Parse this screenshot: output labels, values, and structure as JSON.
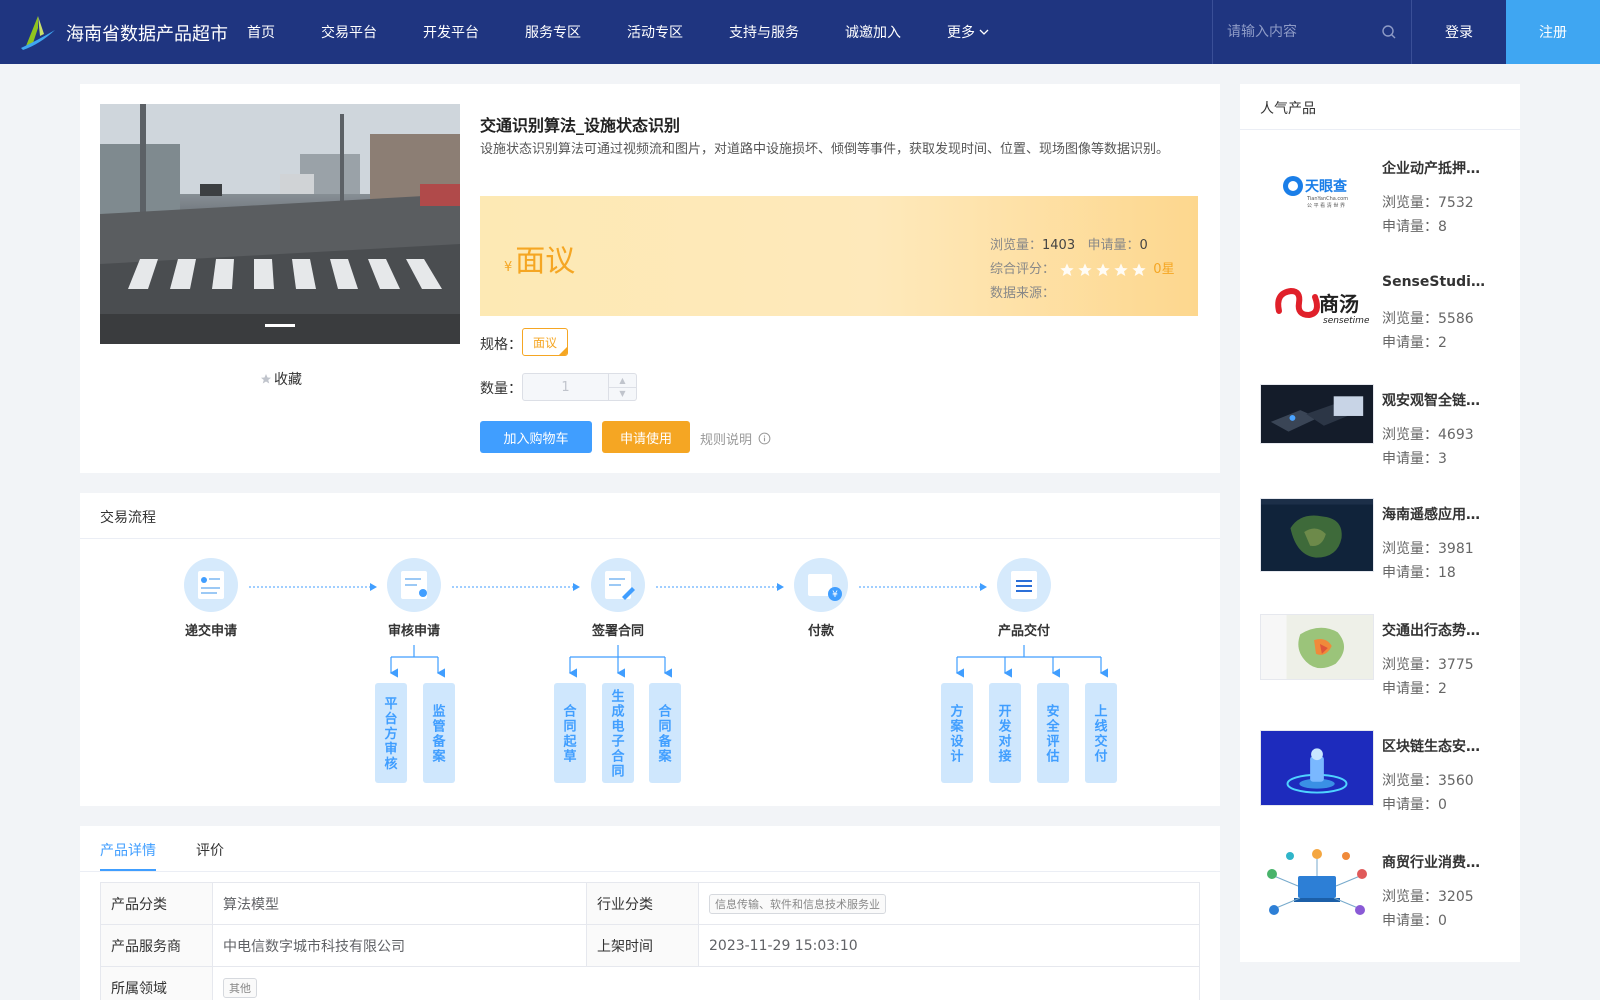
{
  "header": {
    "brand": "海南省数据产品超市",
    "nav": [
      "首页",
      "交易平台",
      "开发平台",
      "服务专区",
      "活动专区",
      "支持与服务",
      "诚邀加入"
    ],
    "more": "更多",
    "search_placeholder": "请输入内容",
    "login": "登录",
    "register": "注册"
  },
  "product": {
    "title": "交通识别算法_设施状态识别",
    "description": "设施状态识别算法可通过视频流和图片，对道路中设施损坏、倾倒等事件，获取发现时间、位置、现场图像等数据识别。",
    "currency": "¥",
    "price": "面议",
    "views_label": "浏览量：",
    "views": "1403",
    "applies_label": "申请量：",
    "applies": "0",
    "rating_label": "综合评分：",
    "rating_text": "0星",
    "rating_value": 0,
    "source_label": "数据来源：",
    "favorite": "收藏",
    "spec_label": "规格：",
    "spec_value": "面议",
    "qty_label": "数量：",
    "qty_value": "1",
    "add_cart": "加入购物车",
    "apply": "申请使用",
    "rules": "规则说明",
    "colors": {
      "accent": "#409eff",
      "price": "#f5a623"
    }
  },
  "flow": {
    "title": "交易流程",
    "steps": [
      "递交申请",
      "审核申请",
      "签署合同",
      "付款",
      "产品交付"
    ],
    "sub_audit": [
      "平台方审核",
      "监管备案"
    ],
    "sub_sign": [
      "合同起草",
      "生成电子合同",
      "合同备案"
    ],
    "sub_deliver": [
      "方案设计",
      "开发对接",
      "安全评估",
      "上线交付"
    ]
  },
  "details": {
    "tabs": [
      "产品详情",
      "评价"
    ],
    "rows": [
      {
        "label1": "产品分类",
        "value1": "算法模型",
        "label2": "行业分类",
        "value2": "信息传输、软件和信息技术服务业"
      },
      {
        "label1": "产品服务商",
        "value1": "中电信数字城市科技有限公司",
        "label2": "上架时间",
        "value2": "2023-11-29 15:03:10"
      },
      {
        "label1": "所属领域",
        "value1": "其他"
      }
    ]
  },
  "sidebar": {
    "title": "人气产品",
    "views_label": "浏览量：",
    "applies_label": "申请量：",
    "items": [
      {
        "name": "企业动产抵押…",
        "views": "7532",
        "applies": "8"
      },
      {
        "name": "SenseStudio…",
        "views": "5586",
        "applies": "2"
      },
      {
        "name": "观安观智全链…",
        "views": "4693",
        "applies": "3"
      },
      {
        "name": "海南遥感应用…",
        "views": "3981",
        "applies": "18"
      },
      {
        "name": "交通出行态势…",
        "views": "3775",
        "applies": "2"
      },
      {
        "name": "区块链生态安…",
        "views": "3560",
        "applies": "0"
      },
      {
        "name": "商贸行业消费…",
        "views": "3205",
        "applies": "0"
      }
    ],
    "logo_texts": {
      "tianyancha_en": "TianYanCha.com",
      "tianyancha_sub": "公 平 看 清 世 界",
      "sensetime_cn": "商汤",
      "sensetime_en": "sensetime"
    }
  }
}
